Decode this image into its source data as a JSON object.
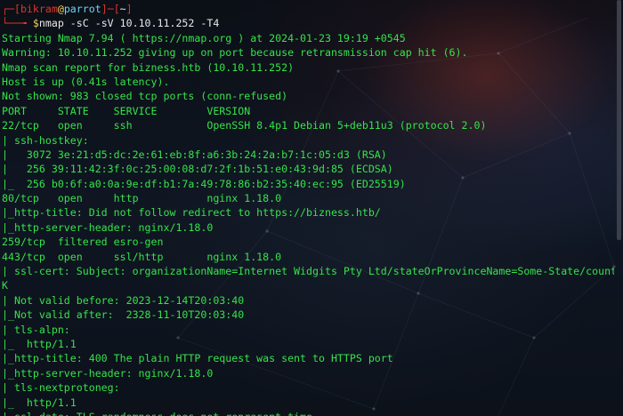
{
  "prompt": {
    "box_top": "┌─",
    "lb": "[",
    "user": "bikram",
    "at": "@",
    "host": "parrot",
    "rb": "]",
    "dash": "─",
    "dir_lb": "[",
    "dir": "~",
    "dir_rb": "]",
    "box_bottom": "└──╼ ",
    "dollar": "$",
    "command": "nmap -sC -sV 10.10.11.252 -T4"
  },
  "output_lines": [
    "Starting Nmap 7.94 ( https://nmap.org ) at 2024-01-23 19:19 +0545",
    "Warning: 10.10.11.252 giving up on port because retransmission cap hit (6).",
    "Nmap scan report for bizness.htb (10.10.11.252)",
    "Host is up (0.41s latency).",
    "Not shown: 983 closed tcp ports (conn-refused)",
    "PORT     STATE    SERVICE        VERSION",
    "22/tcp   open     ssh            OpenSSH 8.4p1 Debian 5+deb11u3 (protocol 2.0)",
    "| ssh-hostkey:",
    "|   3072 3e:21:d5:dc:2e:61:eb:8f:a6:3b:24:2a:b7:1c:05:d3 (RSA)",
    "|   256 39:11:42:3f:0c:25:00:08:d7:2f:1b:51:e0:43:9d:85 (ECDSA)",
    "|_  256 b0:6f:a0:0a:9e:df:b1:7a:49:78:86:b2:35:40:ec:95 (ED25519)",
    "80/tcp   open     http           nginx 1.18.0",
    "|_http-title: Did not follow redirect to https://bizness.htb/",
    "|_http-server-header: nginx/1.18.0",
    "259/tcp  filtered esro-gen",
    "443/tcp  open     ssl/http       nginx 1.18.0",
    "| ssl-cert: Subject: organizationName=Internet Widgits Pty Ltd/stateOrProvinceName=Some-State/countryName=U",
    "K",
    "| Not valid before: 2023-12-14T20:03:40",
    "|_Not valid after:  2328-11-10T20:03:40",
    "| tls-alpn:",
    "|_  http/1.1",
    "|_http-title: 400 The plain HTTP request was sent to HTTPS port",
    "|_http-server-header: nginx/1.18.0",
    "| tls-nextprotoneg:",
    "|_  http/1.1",
    "|_ssl-date: TLS randomness does not represent time"
  ]
}
